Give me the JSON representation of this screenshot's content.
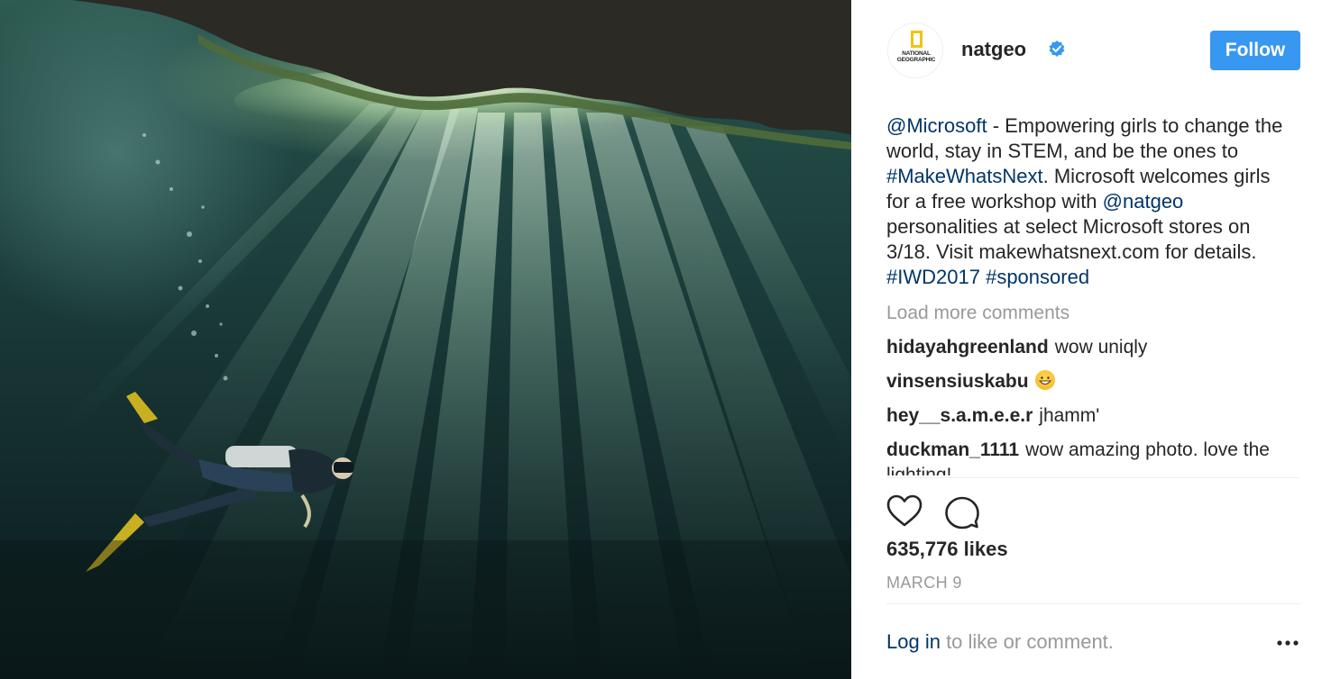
{
  "post": {
    "username": "natgeo",
    "verified": true,
    "avatar_logo_text": "NATIONAL GEOGRAPHIC",
    "follow_label": "Follow",
    "photo_description_icon": "underwater-cenote-diver-photo"
  },
  "caption": {
    "mention": "@Microsoft",
    "text_1": " - Empowering girls to change the world, stay in STEM, and be the ones to ",
    "hashtag_1": "#MakeWhatsNext",
    "text_2": ". Microsoft welcomes girls for a free workshop with ",
    "mention_2": "@natgeo",
    "text_3": " personalities at select Microsoft stores on 3/18. Visit makewhatsnext.com for details. ",
    "hashtag_2": "#IWD2017",
    "hashtag_3": "#sponsored"
  },
  "comments": {
    "load_more": "Load more comments",
    "items": [
      {
        "user": "hidayahgreenland",
        "text": "wow uniqly"
      },
      {
        "user": "vinsensiuskabu",
        "text": ""
      },
      {
        "user": "hey__s.a.m.e.e.r",
        "text": "jhamm'"
      },
      {
        "user": "duckman_1111",
        "text": "wow amazing photo. love the lighting!"
      }
    ]
  },
  "stats": {
    "likes": "635,776 likes",
    "date": "MARCH 9"
  },
  "footer": {
    "login_label": "Log in",
    "login_suffix": " to like or comment."
  },
  "colors": {
    "follow_button": "#3897f0",
    "link": "#003569",
    "muted": "#999999",
    "verified_badge": "#3897f0"
  },
  "icons": {
    "like": "heart-icon",
    "comment": "comment-bubble-icon",
    "more": "more-options-icon",
    "verified": "verified-badge-icon"
  }
}
